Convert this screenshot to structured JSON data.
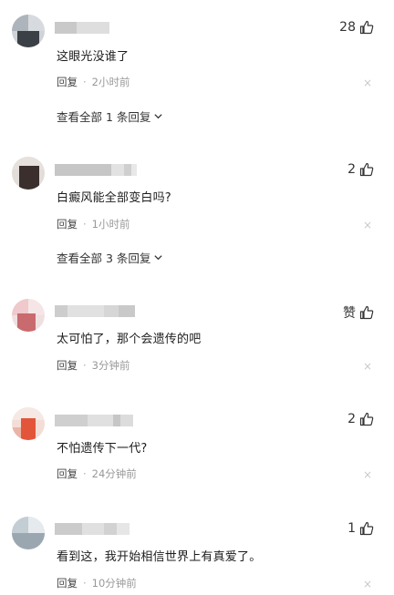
{
  "reply_label": "回复",
  "dot": "·",
  "close_glyph": "×",
  "comments": [
    {
      "likes": "28",
      "text": "这眼光没谁了",
      "time": "2小时前",
      "expand": "查看全部 1 条回复"
    },
    {
      "likes": "2",
      "text": "白癜风能全部变白吗?",
      "time": "1小时前",
      "expand": "查看全部 3 条回复"
    },
    {
      "likes": "赞",
      "text": "太可怕了，那个会遗传的吧",
      "time": "3分钟前"
    },
    {
      "likes": "2",
      "text": "不怕遗传下一代?",
      "time": "24分钟前"
    },
    {
      "likes": "1",
      "text": "看到这，我开始相信世界上有真爱了。",
      "time": "10分钟前"
    }
  ]
}
